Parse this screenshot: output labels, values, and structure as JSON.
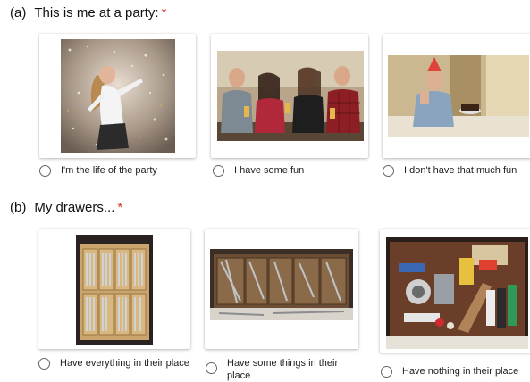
{
  "question_a": {
    "marker": "(a)",
    "title": "This is me at a party:",
    "required": "*",
    "options": [
      {
        "label": "I'm the life of the party",
        "image_icon": "party-dancer-photo"
      },
      {
        "label": "I have some fun",
        "image_icon": "friends-laughing-photo"
      },
      {
        "label": "I don't have that much fun",
        "image_icon": "bored-at-party-photo"
      }
    ]
  },
  "question_b": {
    "marker": "(b)",
    "title": "My drawers...",
    "required": "*",
    "options": [
      {
        "label": "Have everything in their place",
        "image_icon": "organized-drawer-photo"
      },
      {
        "label": "Have some things in their place",
        "image_icon": "semi-organized-drawer-photo"
      },
      {
        "label": "Have nothing in their place",
        "image_icon": "messy-drawer-photo"
      }
    ]
  },
  "colors": {
    "required_asterisk": "#d93025",
    "radio_border": "#5f6368",
    "text": "#202124"
  }
}
